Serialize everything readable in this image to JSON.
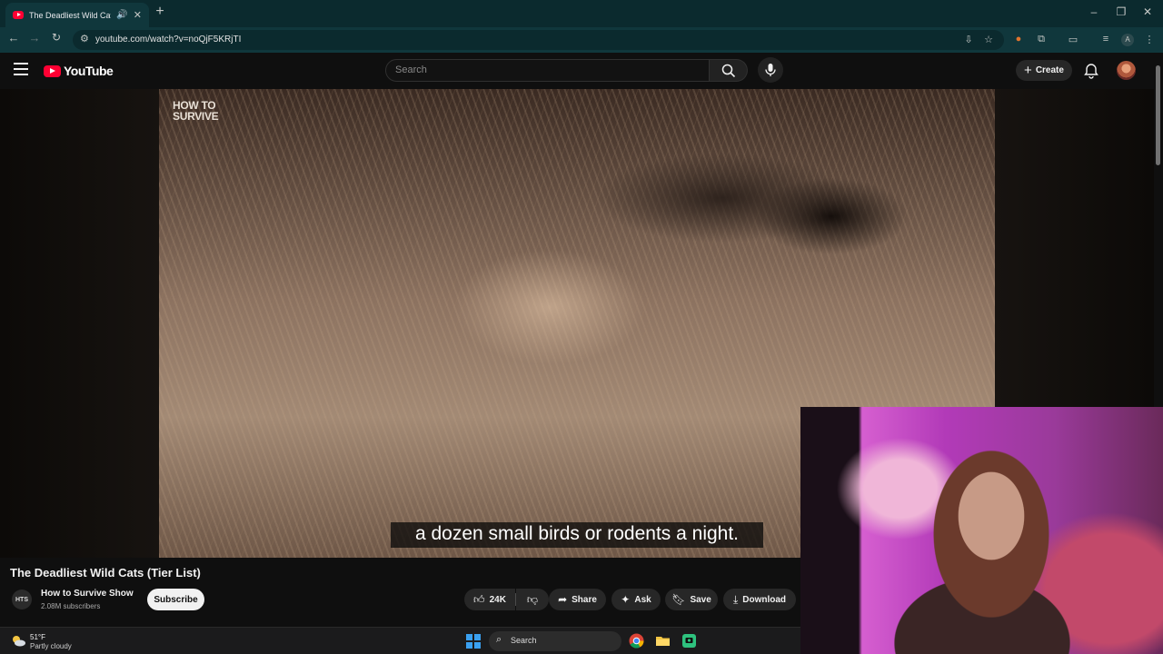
{
  "browser": {
    "tab_title": "The Deadliest Wild Cats (Tier List)",
    "new_tab": "+",
    "url": "youtube.com/watch?v=noQjF5KRjTI",
    "profile_initial": "A"
  },
  "youtube": {
    "logo_text": "YouTube",
    "search_placeholder": "Search",
    "create_label": "Create"
  },
  "video": {
    "watermark_line1": "HOW TO",
    "watermark_line2": "SURVIVE",
    "caption": "a dozen small birds or rodents a night.",
    "title": "The Deadliest Wild Cats (Tier List)"
  },
  "channel": {
    "avatar_text": "HTS",
    "name": "How to Survive Show",
    "subscribers": "2.08M subscribers",
    "subscribe_label": "Subscribe"
  },
  "actions": {
    "likes": "24K",
    "share": "Share",
    "ask": "Ask",
    "save": "Save",
    "download": "Download"
  },
  "taskbar": {
    "temperature": "51°F",
    "condition": "Partly cloudy",
    "search_label": "Search"
  },
  "colors": {
    "youtube_red": "#ff0033",
    "chrome_frame": "#0b2a2e",
    "page_bg": "#0f0f0f"
  }
}
